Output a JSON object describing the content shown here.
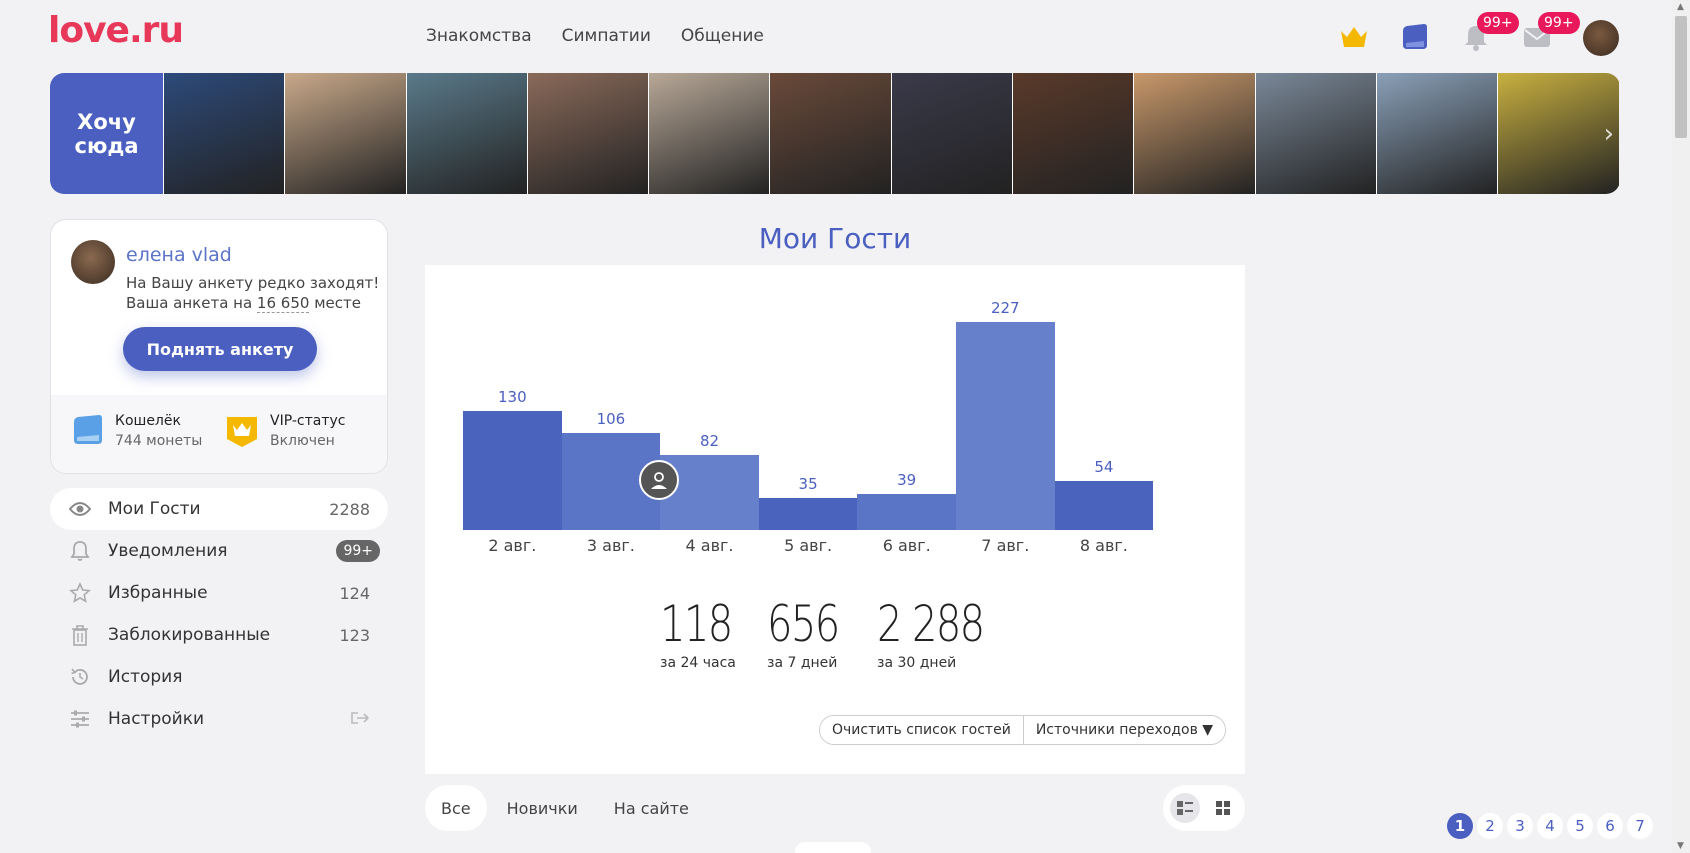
{
  "header": {
    "logo": "love.ru",
    "nav": [
      "Знакомства",
      "Симпатии",
      "Общение"
    ],
    "notif_badge": "99+",
    "msg_badge": "99+"
  },
  "strip": {
    "cta": "Хочу сюда",
    "photos": [
      "#2d4a7a",
      "#c9a98a",
      "#5a7a8a",
      "#8a6a5a",
      "#b8a898",
      "#6a4a3a",
      "#3a3a4a",
      "#5a3a2a",
      "#c8986a",
      "#7a8898",
      "#8aa0b8",
      "#c8b040"
    ]
  },
  "profile": {
    "name": "елена vlad",
    "note_line1": "На Вашу анкету редко заходят!",
    "note_prefix": "Ваша анкета на ",
    "rank": "16 650",
    "note_suffix": " месте",
    "raise_button": "Поднять анкету",
    "wallet_title": "Кошелёк",
    "wallet_sub": "744 монеты",
    "vip_title": "VIP-статус",
    "vip_sub": "Включен"
  },
  "menu": [
    {
      "label": "Мои Гости",
      "count": "2288",
      "icon": "eye-icon"
    },
    {
      "label": "Уведомления",
      "count": "99+",
      "icon": "bell-icon"
    },
    {
      "label": "Избранные",
      "count": "124",
      "icon": "star-icon"
    },
    {
      "label": "Заблокированные",
      "count": "123",
      "icon": "trash-icon"
    },
    {
      "label": "История",
      "count": "",
      "icon": "history-icon"
    },
    {
      "label": "Настройки",
      "count": "",
      "icon": "settings-icon"
    }
  ],
  "main": {
    "title": "Мои Гости",
    "stats": [
      {
        "value": "118",
        "label": "за 24 часа"
      },
      {
        "value": "656",
        "label": "за 7 дней"
      },
      {
        "value": "2 288",
        "label": "за 30 дней"
      }
    ],
    "clear_button": "Очистить список гостей",
    "sources_button": "Источники переходов ▼"
  },
  "chart_data": {
    "type": "bar",
    "categories": [
      "2 авг.",
      "3 авг.",
      "4 авг.",
      "5 авг.",
      "6 авг.",
      "7 авг.",
      "8 авг."
    ],
    "values": [
      130,
      106,
      82,
      35,
      39,
      227,
      54
    ],
    "colors": [
      "#4a64bd",
      "#5a74c6",
      "#6680cb",
      "#4a64bd",
      "#5a74c6",
      "#6680cb",
      "#4a64bd"
    ],
    "ylim": [
      0,
      227
    ]
  },
  "filters": {
    "tabs": [
      "Все",
      "Новички",
      "На сайте"
    ]
  },
  "pagination": [
    "1",
    "2",
    "3",
    "4",
    "5",
    "6",
    "7"
  ]
}
